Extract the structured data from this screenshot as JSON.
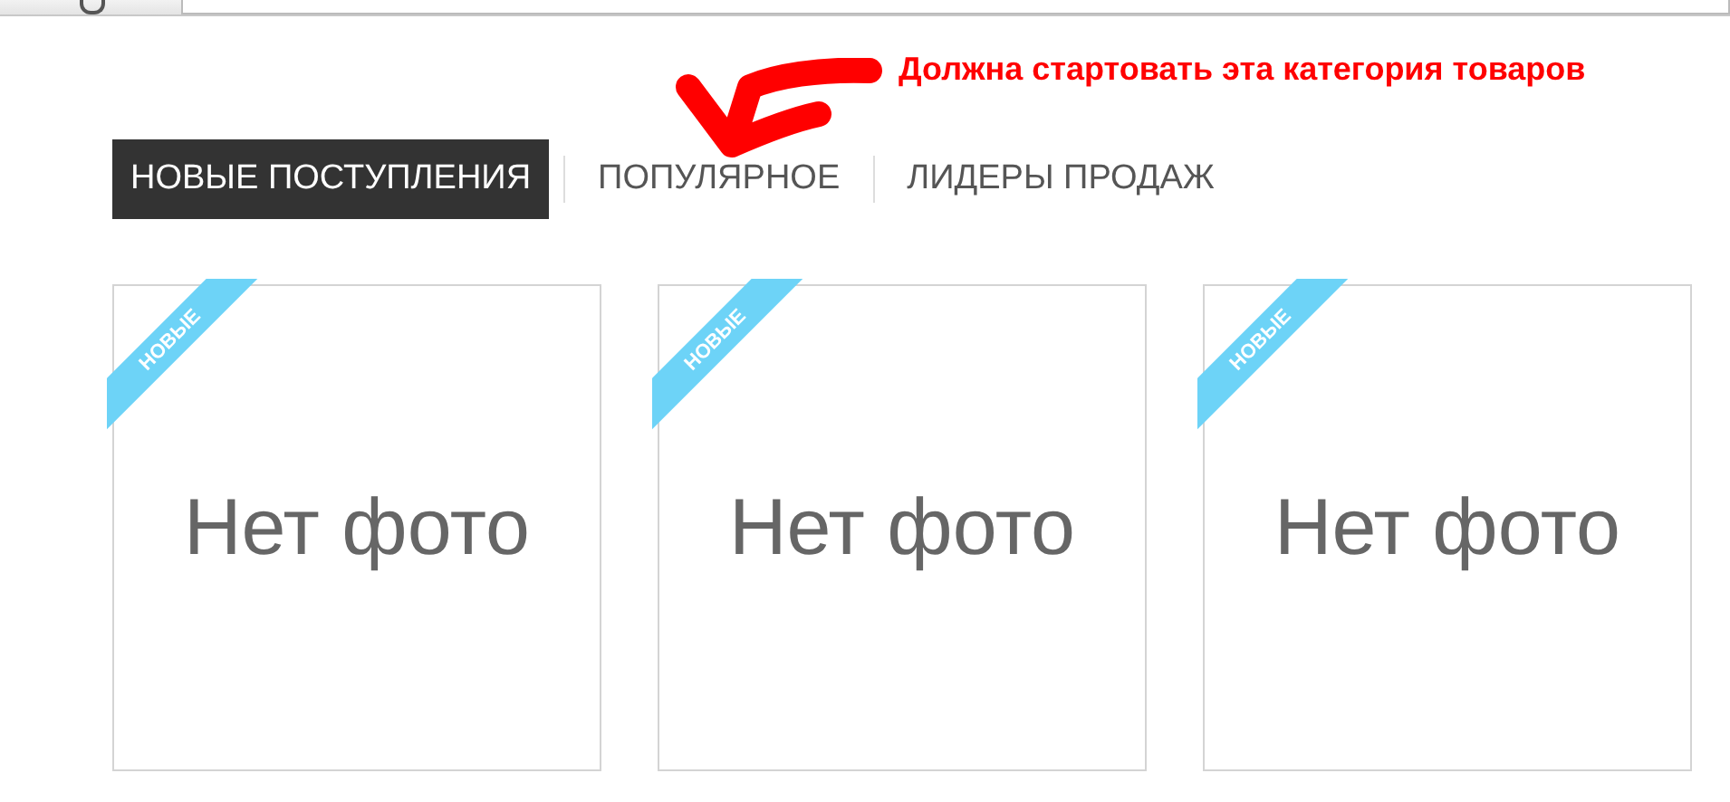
{
  "annotation": {
    "text": "Должна стартовать эта категория товаров"
  },
  "tabs": [
    {
      "label": "НОВЫЕ ПОСТУПЛЕНИЯ",
      "selected": true
    },
    {
      "label": "ПОПУЛЯРНОЕ",
      "selected": false
    },
    {
      "label": "ЛИДЕРЫ ПРОДАЖ",
      "selected": false
    }
  ],
  "products": [
    {
      "ribbon": "НОВЫЕ",
      "image_text": "Нет фото"
    },
    {
      "ribbon": "НОВЫЕ",
      "image_text": "Нет фото"
    },
    {
      "ribbon": "НОВЫЕ",
      "image_text": "Нет фото"
    }
  ]
}
